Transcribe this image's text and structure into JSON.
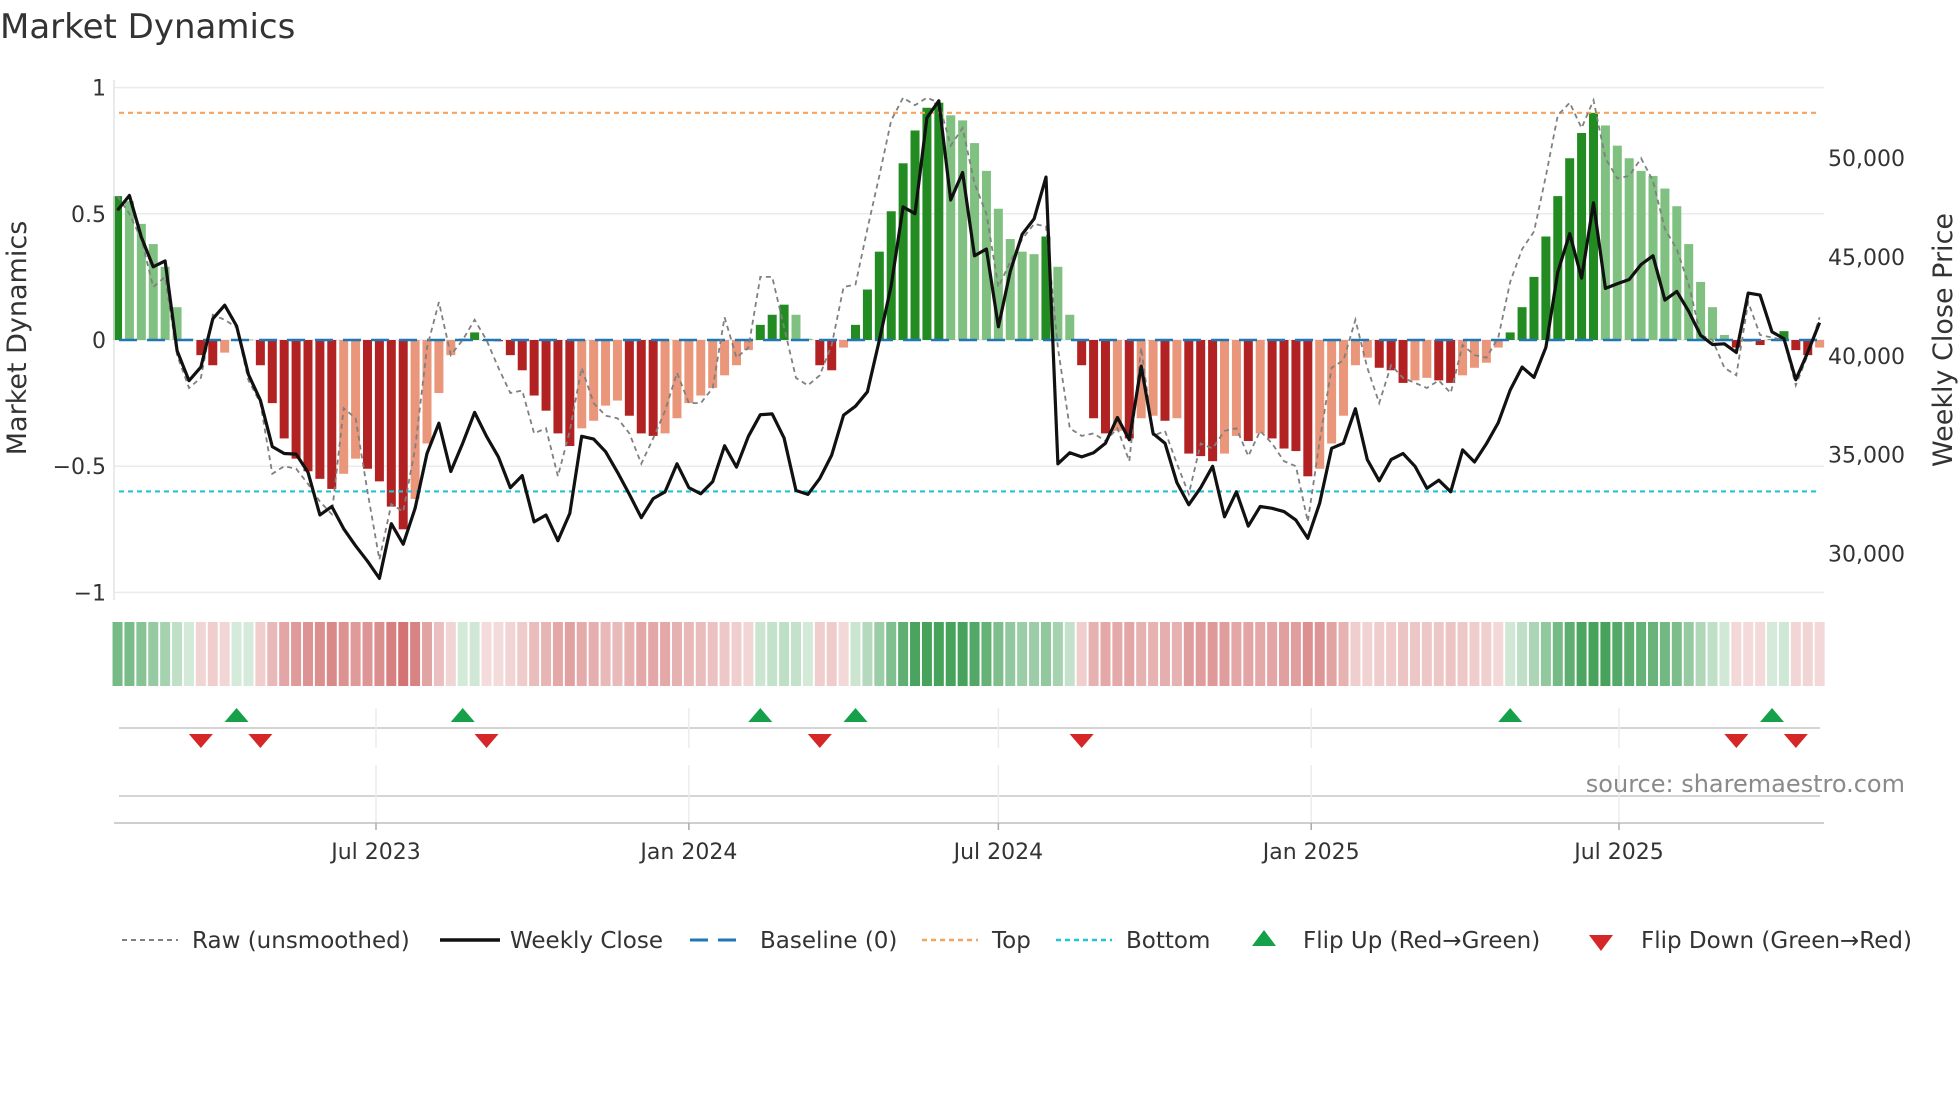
{
  "title": "Market Dynamics",
  "source": "source: sharemaestro.com",
  "colors": {
    "bar_up_strong": "#228b22",
    "bar_up_weak": "#80c080",
    "bar_down_strong": "#b22222",
    "bar_down_weak": "#e9967a",
    "raw": "#808080",
    "close": "#111111",
    "baseline": "#1f77b4",
    "top": "#f4a460",
    "bottom": "#22c3d3",
    "flip_up": "#16a04a",
    "flip_down": "#d62728",
    "strip_green": "#2e9646",
    "strip_red": "#c85050",
    "grid": "#ebebeb"
  },
  "legend": {
    "raw": "Raw (unsmoothed)",
    "close": "Weekly Close",
    "baseline": "Baseline (0)",
    "top": "Top",
    "bottom": "Bottom",
    "flip_up": "Flip Up (Red→Green)",
    "flip_down": "Flip Down (Green→Red)"
  },
  "chart_data": {
    "type": "bar",
    "title": "Market Dynamics",
    "ylabel": "Market Dynamics",
    "y2label": "Weekly Close Price",
    "ylim": [
      -1.03,
      1.03
    ],
    "y2lim": [
      27650,
      53950
    ],
    "grid": true,
    "legend_placement": "bottom",
    "thresholds": {
      "baseline": 0,
      "top": 0.9,
      "bottom": -0.6
    },
    "y_ticks": [
      {
        "value": 1,
        "label": "1"
      },
      {
        "value": 0.5,
        "label": "0.5"
      },
      {
        "value": 0,
        "label": "0"
      },
      {
        "value": -0.5,
        "label": "−0.5"
      },
      {
        "value": -1,
        "label": "−1"
      }
    ],
    "y2_ticks": [
      {
        "value": 30000,
        "label": "30,000"
      },
      {
        "value": 35000,
        "label": "35,000"
      },
      {
        "value": 40000,
        "label": "40,000"
      },
      {
        "value": 45000,
        "label": "45,000"
      },
      {
        "value": 50000,
        "label": "50,000"
      }
    ],
    "x_ticks": [
      {
        "date": "2023-07-01",
        "label": "Jul 2023"
      },
      {
        "date": "2024-01-01",
        "label": "Jan 2024"
      },
      {
        "date": "2024-07-01",
        "label": "Jul 2024"
      },
      {
        "date": "2025-01-01",
        "label": "Jan 2025"
      },
      {
        "date": "2025-07-01",
        "label": "Jul 2025"
      }
    ],
    "x": [
      "2023-01-30",
      "2023-02-06",
      "2023-02-13",
      "2023-02-20",
      "2023-02-27",
      "2023-03-06",
      "2023-03-13",
      "2023-03-20",
      "2023-03-27",
      "2023-04-03",
      "2023-04-10",
      "2023-04-17",
      "2023-04-24",
      "2023-05-01",
      "2023-05-08",
      "2023-05-15",
      "2023-05-22",
      "2023-05-29",
      "2023-06-05",
      "2023-06-12",
      "2023-06-19",
      "2023-06-26",
      "2023-07-03",
      "2023-07-10",
      "2023-07-17",
      "2023-07-24",
      "2023-07-31",
      "2023-08-07",
      "2023-08-14",
      "2023-08-21",
      "2023-08-28",
      "2023-09-04",
      "2023-09-11",
      "2023-09-18",
      "2023-09-25",
      "2023-10-02",
      "2023-10-09",
      "2023-10-16",
      "2023-10-23",
      "2023-10-30",
      "2023-11-06",
      "2023-11-13",
      "2023-11-20",
      "2023-11-27",
      "2023-12-04",
      "2023-12-11",
      "2023-12-18",
      "2023-12-25",
      "2024-01-01",
      "2024-01-08",
      "2024-01-15",
      "2024-01-22",
      "2024-01-29",
      "2024-02-05",
      "2024-02-12",
      "2024-02-19",
      "2024-02-26",
      "2024-03-04",
      "2024-03-11",
      "2024-03-18",
      "2024-03-25",
      "2024-04-01",
      "2024-04-08",
      "2024-04-15",
      "2024-04-22",
      "2024-04-29",
      "2024-05-06",
      "2024-05-13",
      "2024-05-20",
      "2024-05-27",
      "2024-06-03",
      "2024-06-10",
      "2024-06-17",
      "2024-06-24",
      "2024-07-01",
      "2024-07-08",
      "2024-07-15",
      "2024-07-22",
      "2024-07-29",
      "2024-08-05",
      "2024-08-12",
      "2024-08-19",
      "2024-08-26",
      "2024-09-02",
      "2024-09-09",
      "2024-09-16",
      "2024-09-23",
      "2024-09-30",
      "2024-10-07",
      "2024-10-14",
      "2024-10-21",
      "2024-10-28",
      "2024-11-04",
      "2024-11-11",
      "2024-11-18",
      "2024-11-25",
      "2024-12-02",
      "2024-12-09",
      "2024-12-16",
      "2024-12-23",
      "2024-12-30",
      "2025-01-06",
      "2025-01-13",
      "2025-01-20",
      "2025-01-27",
      "2025-02-03",
      "2025-02-10",
      "2025-02-17",
      "2025-02-24",
      "2025-03-03",
      "2025-03-10",
      "2025-03-17",
      "2025-03-24",
      "2025-03-31",
      "2025-04-07",
      "2025-04-14",
      "2025-04-21",
      "2025-04-28",
      "2025-05-05",
      "2025-05-12",
      "2025-05-19",
      "2025-05-26",
      "2025-06-02",
      "2025-06-09",
      "2025-06-16",
      "2025-06-23",
      "2025-06-30",
      "2025-07-07",
      "2025-07-14",
      "2025-07-21",
      "2025-07-28",
      "2025-08-04",
      "2025-08-11",
      "2025-08-18",
      "2025-08-25",
      "2025-09-01",
      "2025-09-08",
      "2025-09-15",
      "2025-09-22",
      "2025-09-29",
      "2025-10-06",
      "2025-10-13",
      "2025-10-20",
      "2025-10-27"
    ],
    "series": [
      {
        "name": "Market Dynamics",
        "role": "bars",
        "values": [
          0.57,
          0.55,
          0.46,
          0.38,
          0.29,
          0.13,
          0.005,
          -0.06,
          -0.1,
          -0.05,
          0.003,
          0.002,
          -0.1,
          -0.25,
          -0.39,
          -0.47,
          -0.52,
          -0.55,
          -0.59,
          -0.53,
          -0.47,
          -0.51,
          -0.56,
          -0.66,
          -0.75,
          -0.63,
          -0.41,
          -0.21,
          -0.06,
          0.005,
          0.03,
          -0.003,
          -0.005,
          -0.06,
          -0.12,
          -0.22,
          -0.28,
          -0.37,
          -0.42,
          -0.35,
          -0.32,
          -0.26,
          -0.24,
          -0.3,
          -0.37,
          -0.38,
          -0.37,
          -0.31,
          -0.25,
          -0.22,
          -0.19,
          -0.14,
          -0.1,
          -0.04,
          0.06,
          0.1,
          0.14,
          0.1,
          0.005,
          -0.1,
          -0.12,
          -0.03,
          0.06,
          0.2,
          0.35,
          0.51,
          0.7,
          0.83,
          0.92,
          0.94,
          0.89,
          0.87,
          0.78,
          0.67,
          0.52,
          0.4,
          0.35,
          0.34,
          0.41,
          0.29,
          0.1,
          -0.1,
          -0.31,
          -0.37,
          -0.36,
          -0.39,
          -0.31,
          -0.3,
          -0.32,
          -0.31,
          -0.45,
          -0.46,
          -0.48,
          -0.45,
          -0.38,
          -0.4,
          -0.37,
          -0.39,
          -0.43,
          -0.44,
          -0.54,
          -0.51,
          -0.41,
          -0.3,
          -0.1,
          -0.07,
          -0.11,
          -0.12,
          -0.17,
          -0.16,
          -0.15,
          -0.16,
          -0.17,
          -0.14,
          -0.11,
          -0.09,
          -0.03,
          0.03,
          0.13,
          0.25,
          0.41,
          0.57,
          0.72,
          0.82,
          0.9,
          0.85,
          0.77,
          0.72,
          0.67,
          0.65,
          0.6,
          0.53,
          0.38,
          0.23,
          0.13,
          0.02,
          -0.03,
          -0.007,
          -0.02,
          0.003,
          0.035,
          -0.04,
          -0.06,
          -0.03
        ]
      },
      {
        "name": "Raw (unsmoothed)",
        "role": "raw",
        "values": [
          0.57,
          0.5,
          0.4,
          0.21,
          0.25,
          -0.06,
          -0.19,
          -0.15,
          0.1,
          0.08,
          0.05,
          -0.16,
          -0.25,
          -0.53,
          -0.5,
          -0.51,
          -0.57,
          -0.64,
          -0.69,
          -0.27,
          -0.31,
          -0.6,
          -0.87,
          -0.65,
          -0.68,
          -0.43,
          -0.03,
          0.15,
          -0.06,
          0.0,
          0.08,
          0.0,
          -0.11,
          -0.21,
          -0.2,
          -0.37,
          -0.35,
          -0.54,
          -0.36,
          -0.11,
          -0.25,
          -0.3,
          -0.31,
          -0.37,
          -0.49,
          -0.39,
          -0.28,
          -0.13,
          -0.25,
          -0.25,
          -0.19,
          0.09,
          -0.07,
          -0.03,
          0.25,
          0.25,
          0.05,
          -0.15,
          -0.18,
          -0.14,
          -0.02,
          0.21,
          0.22,
          0.44,
          0.65,
          0.87,
          0.96,
          0.93,
          0.96,
          0.94,
          0.77,
          0.84,
          0.62,
          0.5,
          0.21,
          0.31,
          0.4,
          0.46,
          0.45,
          -0.03,
          -0.35,
          -0.38,
          -0.37,
          -0.4,
          -0.35,
          -0.48,
          -0.03,
          -0.38,
          -0.36,
          -0.49,
          -0.61,
          -0.41,
          -0.43,
          -0.36,
          -0.35,
          -0.46,
          -0.36,
          -0.41,
          -0.48,
          -0.5,
          -0.72,
          -0.4,
          -0.11,
          -0.08,
          0.08,
          -0.11,
          -0.25,
          -0.1,
          -0.15,
          -0.17,
          -0.19,
          -0.16,
          -0.21,
          -0.02,
          -0.06,
          -0.07,
          0.01,
          0.23,
          0.36,
          0.43,
          0.65,
          0.89,
          0.94,
          0.84,
          0.95,
          0.72,
          0.64,
          0.65,
          0.72,
          0.63,
          0.44,
          0.36,
          0.22,
          0.02,
          0.0,
          -0.11,
          -0.14,
          0.15,
          0.02,
          0.01,
          0.0,
          -0.18,
          -0.06,
          0.09
        ]
      },
      {
        "name": "Weekly Close",
        "role": "close",
        "axis": "right",
        "values": [
          47360,
          48110,
          46010,
          44500,
          44800,
          40260,
          38740,
          39430,
          41870,
          42560,
          41510,
          39050,
          37750,
          35410,
          35060,
          35030,
          34110,
          31950,
          32380,
          31250,
          30390,
          29610,
          28740,
          31510,
          30470,
          32290,
          35060,
          36590,
          34150,
          35580,
          37140,
          35930,
          34890,
          33330,
          33940,
          31600,
          31950,
          30650,
          32030,
          35930,
          35790,
          35150,
          34110,
          32990,
          31810,
          32780,
          33120,
          34540,
          33330,
          33020,
          33640,
          35450,
          34370,
          35930,
          37020,
          37060,
          35840,
          33190,
          32990,
          33800,
          34980,
          37000,
          37450,
          38180,
          40780,
          43550,
          47530,
          47190,
          52040,
          52900,
          47880,
          49270,
          45060,
          45400,
          41470,
          44280,
          46150,
          46930,
          49040,
          34540,
          35100,
          34890,
          35100,
          35580,
          36880,
          35760,
          39480,
          36070,
          35580,
          33590,
          32470,
          33330,
          34410,
          31860,
          33120,
          31390,
          32380,
          32290,
          32120,
          31690,
          30770,
          32550,
          35320,
          35580,
          37320,
          34750,
          33680,
          34750,
          35060,
          34410,
          33300,
          33710,
          33120,
          35240,
          34630,
          35550,
          36620,
          38270,
          39430,
          38910,
          40430,
          44240,
          46180,
          43930,
          47740,
          43410,
          43640,
          43860,
          44620,
          45060,
          42820,
          43260,
          42250,
          41040,
          40570,
          40610,
          40170,
          43170,
          43070,
          41210,
          40870,
          38790,
          40170,
          41680
        ]
      }
    ],
    "flips_up": [
      "2023-04-10",
      "2023-08-21",
      "2024-02-12",
      "2024-04-08",
      "2025-04-28",
      "2025-09-29"
    ],
    "flips_down": [
      "2023-03-20",
      "2023-04-24",
      "2023-09-04",
      "2024-03-18",
      "2024-08-19",
      "2025-09-08",
      "2025-10-13"
    ]
  }
}
